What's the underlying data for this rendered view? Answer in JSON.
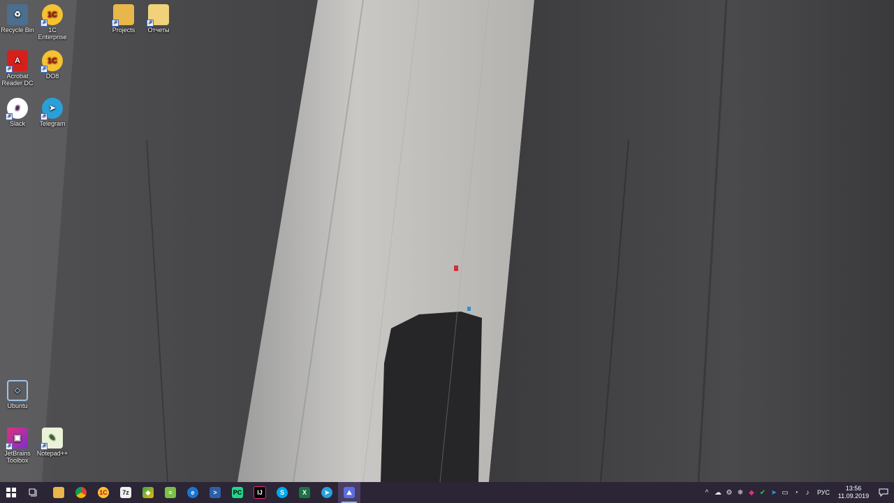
{
  "desktop_icons": [
    {
      "label": "Recycle Bin",
      "icon": "recycle-bin-icon",
      "color": "#5f8fb8"
    },
    {
      "label": "1C Enterprise",
      "icon": "1c-enterprise-icon",
      "color": "#f6c232",
      "text": "1C"
    },
    {
      "label": "Projects",
      "icon": "folder-icon",
      "color": "#e8b64a"
    },
    {
      "label": "Отчеты",
      "icon": "folder-icon",
      "color": "#efd27a"
    },
    {
      "label": "Acrobat Reader DC",
      "icon": "acrobat-reader-icon",
      "color": "#d6201c"
    },
    {
      "label": "DO8",
      "icon": "1c-do8-icon",
      "color": "#f6c232",
      "text": "1C"
    },
    {
      "label": "Slack",
      "icon": "slack-icon",
      "color": "#ffffff"
    },
    {
      "label": "Telegram",
      "icon": "telegram-icon",
      "color": "#2aa0da"
    },
    {
      "label": "Ubuntu",
      "icon": "ubuntu-icon",
      "color": "#6aa0d8"
    },
    {
      "label": "JetBrains Toolbox",
      "icon": "jetbrains-toolbox-icon",
      "color": "#e0317a"
    },
    {
      "label": "Notepad++",
      "icon": "notepad-plus-plus-icon",
      "color": "#7cc048"
    }
  ],
  "taskbar": {
    "start_icon": "windows-start-icon",
    "task_view_icon": "task-view-icon",
    "apps": [
      {
        "name": "file-explorer",
        "icon": "folder-icon",
        "color": "#e8b64a",
        "running": false
      },
      {
        "name": "chrome",
        "icon": "chrome-icon",
        "color": "#db4437",
        "running": false
      },
      {
        "name": "1c",
        "icon": "1c-icon",
        "color": "#f6c232",
        "running": false
      },
      {
        "name": "7zip",
        "icon": "7zip-icon",
        "color": "#222222",
        "running": false
      },
      {
        "name": "git-kraken",
        "icon": "git-icon",
        "color": "#33a853",
        "running": false
      },
      {
        "name": "notepad",
        "icon": "document-icon",
        "color": "#7cc048",
        "running": false
      },
      {
        "name": "edge",
        "icon": "edge-icon",
        "color": "#1a74d1",
        "running": false
      },
      {
        "name": "powershell",
        "icon": "powershell-icon",
        "color": "#2d5fa8",
        "running": false
      },
      {
        "name": "pycharm",
        "icon": "pycharm-icon",
        "color": "#21d789",
        "running": false
      },
      {
        "name": "intellij",
        "icon": "intellij-icon",
        "color": "#e0317a",
        "running": false
      },
      {
        "name": "skype",
        "icon": "skype-icon",
        "color": "#00a9f0",
        "running": false
      },
      {
        "name": "excel",
        "icon": "excel-icon",
        "color": "#1e7145",
        "running": false
      },
      {
        "name": "telegram",
        "icon": "telegram-icon",
        "color": "#2aa0da",
        "running": false
      },
      {
        "name": "photos",
        "icon": "photos-icon",
        "color": "#5b6ee1",
        "running": true
      }
    ],
    "tray": {
      "icons": [
        "chevron-up-icon",
        "onedrive-icon",
        "network-settings-icon",
        "snowflake-icon",
        "color-app-icon",
        "check-icon",
        "telegram-tray-icon",
        "monitor-icon",
        "wifi-icon",
        "speaker-icon"
      ],
      "language": "РУС",
      "time": "13:56",
      "date": "11.09.2019",
      "notification_icon": "notification-icon"
    }
  }
}
